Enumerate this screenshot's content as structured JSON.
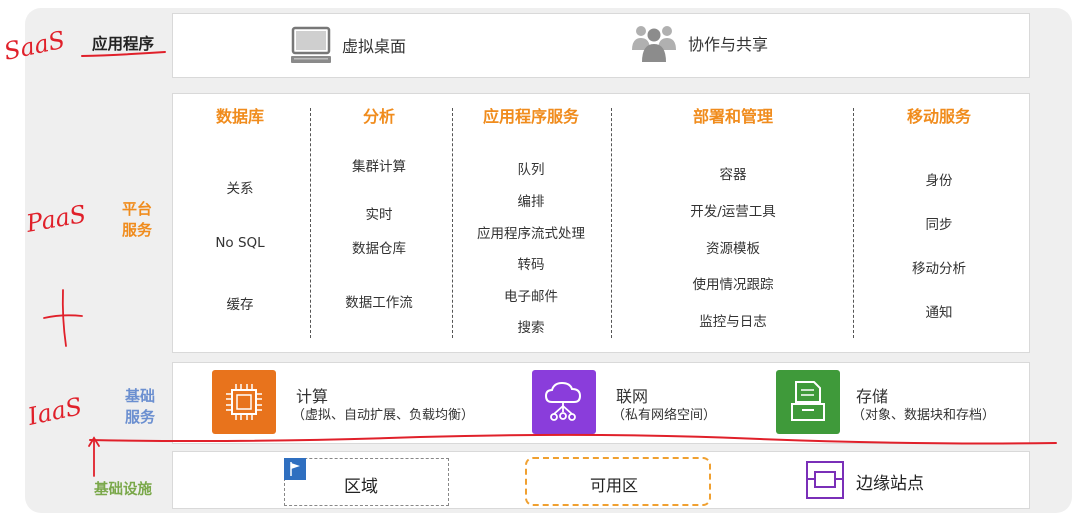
{
  "row_labels": {
    "application": "应用程序",
    "platform_line1": "平台",
    "platform_line2": "服务",
    "foundation_line1": "基础",
    "foundation_line2": "服务",
    "infrastructure": "基础设施"
  },
  "application": {
    "desktop": "虚拟桌面",
    "collab": "协作与共享"
  },
  "platform_columns": [
    {
      "title": "数据库",
      "items": [
        "关系",
        "No SQL",
        "缓存"
      ]
    },
    {
      "title": "分析",
      "items": [
        "集群计算",
        "实时",
        "数据仓库",
        "数据工作流"
      ]
    },
    {
      "title": "应用程序服务",
      "items": [
        "队列",
        "编排",
        "应用程序流式处理",
        "转码",
        "电子邮件",
        "搜索"
      ]
    },
    {
      "title": "部署和管理",
      "items": [
        "容器",
        "开发/运营工具",
        "资源模板",
        "使用情况跟踪",
        "监控与日志"
      ]
    },
    {
      "title": "移动服务",
      "items": [
        "身份",
        "同步",
        "移动分析",
        "通知"
      ]
    }
  ],
  "foundation": {
    "compute_title": "计算",
    "compute_sub": "（虚拟、自动扩展、负载均衡）",
    "network_title": "联网",
    "network_sub": "（私有网络空间）",
    "storage_title": "存储",
    "storage_sub": "（对象、数据块和存档）"
  },
  "infrastructure": {
    "region": "区域",
    "az": "可用区",
    "edge": "边缘站点"
  },
  "annotations": {
    "saas": "SaaS",
    "paas": "PaaS",
    "iaas": "IaaS"
  },
  "colors": {
    "orange_title": "#f08c1d",
    "platform_label": "#f08c1d",
    "foundation_label": "#6b8fd0",
    "infra_label": "#7aa84a",
    "compute": "#e8731c",
    "network": "#8a3ddb",
    "storage": "#3f9a3a",
    "ink": "#e0202a",
    "region_flag": "#2f6fc0",
    "edge": "#7a2fb8"
  }
}
